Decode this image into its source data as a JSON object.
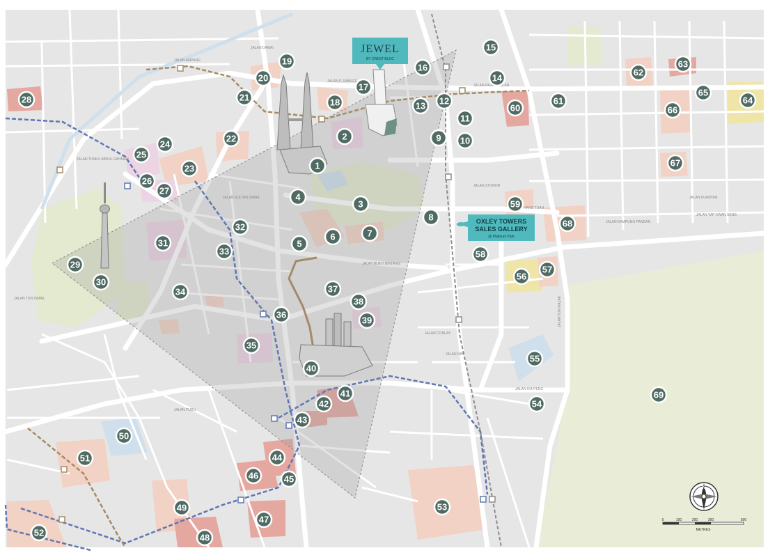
{
  "colors": {
    "background": "#e6e6e6",
    "road": "#ffffff",
    "park": "#e3ead0",
    "big_park": "#e9ecd6",
    "area_peach": "#f1d2c4",
    "area_pink": "#ecd4e4",
    "area_red": "#e4a8a0",
    "area_yellow": "#f0e5a8",
    "area_blue": "#cfe0ec",
    "marker": "#4f6b63",
    "triangle": "#9a9a9a",
    "rail_blue": "#5f76b3",
    "rail_brown": "#a48a66",
    "rail_grey": "#8c8c8c",
    "teal_label": "#4fb9bd"
  },
  "jewel_label": {
    "title": "JEWEL",
    "subtitle": "BY CREST BLOC"
  },
  "sales_gallery": {
    "line1": "OXLEY TOWERS",
    "line2": "SALES GALLERY",
    "line3": "@ Platinum Park"
  },
  "compass": {
    "north": "N",
    "icon": "compass-rose"
  },
  "scale_bar": {
    "ticks": [
      "0",
      "100",
      "200",
      "300",
      "500"
    ],
    "unit": "METRES"
  },
  "road_labels": [
    "JALAN AMPANG",
    "JALAN P. RAMLEE",
    "JALAN RAJA CHULAN",
    "JALAN SULTAN ISMAIL",
    "JALAN BUKIT BINTANG",
    "JALAN TUN RAZAK",
    "JALAN KIA PENG",
    "JALAN IMBI",
    "JALAN PUDU",
    "JALAN HANG TUAH",
    "JALAN CONLAY",
    "JALAN STONOR",
    "JALAN YAP KWAN SENG",
    "JALAN KAMPUNG PANDAN",
    "JALAN TUN ISMAIL",
    "JALAN DAMAI",
    "JALAN KUANTAN",
    "JALAN TUNKU ABDUL RAHMAN"
  ],
  "markers": [
    {
      "n": "1"
    },
    {
      "n": "2"
    },
    {
      "n": "3"
    },
    {
      "n": "4"
    },
    {
      "n": "5"
    },
    {
      "n": "6"
    },
    {
      "n": "7"
    },
    {
      "n": "8"
    },
    {
      "n": "9"
    },
    {
      "n": "10"
    },
    {
      "n": "11"
    },
    {
      "n": "12"
    },
    {
      "n": "13"
    },
    {
      "n": "14"
    },
    {
      "n": "15"
    },
    {
      "n": "16"
    },
    {
      "n": "17"
    },
    {
      "n": "18"
    },
    {
      "n": "19"
    },
    {
      "n": "20"
    },
    {
      "n": "21"
    },
    {
      "n": "22"
    },
    {
      "n": "23"
    },
    {
      "n": "24"
    },
    {
      "n": "25"
    },
    {
      "n": "26"
    },
    {
      "n": "27"
    },
    {
      "n": "28"
    },
    {
      "n": "29"
    },
    {
      "n": "30"
    },
    {
      "n": "31"
    },
    {
      "n": "32"
    },
    {
      "n": "33"
    },
    {
      "n": "34"
    },
    {
      "n": "35"
    },
    {
      "n": "36"
    },
    {
      "n": "37"
    },
    {
      "n": "38"
    },
    {
      "n": "39"
    },
    {
      "n": "40"
    },
    {
      "n": "41"
    },
    {
      "n": "42"
    },
    {
      "n": "43"
    },
    {
      "n": "44"
    },
    {
      "n": "45"
    },
    {
      "n": "46"
    },
    {
      "n": "47"
    },
    {
      "n": "48"
    },
    {
      "n": "49"
    },
    {
      "n": "50"
    },
    {
      "n": "51"
    },
    {
      "n": "52"
    },
    {
      "n": "53"
    },
    {
      "n": "54"
    },
    {
      "n": "55"
    },
    {
      "n": "56"
    },
    {
      "n": "57"
    },
    {
      "n": "58"
    },
    {
      "n": "59"
    },
    {
      "n": "60"
    },
    {
      "n": "61"
    },
    {
      "n": "62"
    },
    {
      "n": "63"
    },
    {
      "n": "64"
    },
    {
      "n": "65"
    },
    {
      "n": "66"
    },
    {
      "n": "67"
    },
    {
      "n": "68"
    },
    {
      "n": "69"
    }
  ]
}
